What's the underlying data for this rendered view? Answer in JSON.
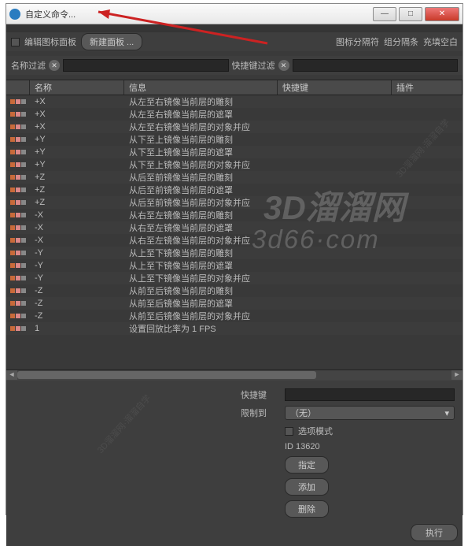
{
  "window": {
    "title": "自定义命令..."
  },
  "toolbar": {
    "edit_icon_panel": "编辑图标面板",
    "new_panel": "新建面板 ...",
    "icon_sep": "图标分隔符",
    "group_sep": "组分隔条",
    "fill_blank": "充填空白"
  },
  "filter": {
    "name_label": "名称过滤",
    "shortcut_label": "快捷键过滤",
    "name_val": "",
    "shortcut_val": ""
  },
  "columns": {
    "name": "名称",
    "info": "信息",
    "shortcut": "快捷键",
    "plugin": "插件"
  },
  "rows": [
    {
      "n": "+X",
      "i": "从左至右镜像当前层的雕刻"
    },
    {
      "n": "+X",
      "i": "从左至右镜像当前层的遮罩"
    },
    {
      "n": "+X",
      "i": "从左至右镜像当前层的对象并应"
    },
    {
      "n": "+Y",
      "i": "从下至上镜像当前层的雕刻"
    },
    {
      "n": "+Y",
      "i": "从下至上镜像当前层的遮罩"
    },
    {
      "n": "+Y",
      "i": "从下至上镜像当前层的对象并应"
    },
    {
      "n": "+Z",
      "i": "从后至前镜像当前层的雕刻"
    },
    {
      "n": "+Z",
      "i": "从后至前镜像当前层的遮罩"
    },
    {
      "n": "+Z",
      "i": "从后至前镜像当前层的对象并应"
    },
    {
      "n": "-X",
      "i": "从右至左镜像当前层的雕刻"
    },
    {
      "n": "-X",
      "i": "从右至左镜像当前层的遮罩"
    },
    {
      "n": "-X",
      "i": "从右至左镜像当前层的对象并应"
    },
    {
      "n": "-Y",
      "i": "从上至下镜像当前层的雕刻"
    },
    {
      "n": "-Y",
      "i": "从上至下镜像当前层的遮罩"
    },
    {
      "n": "-Y",
      "i": "从上至下镜像当前层的对象并应"
    },
    {
      "n": "-Z",
      "i": "从前至后镜像当前层的雕刻"
    },
    {
      "n": "-Z",
      "i": "从前至后镜像当前层的遮罩"
    },
    {
      "n": "-Z",
      "i": "从前至后镜像当前层的对象并应"
    },
    {
      "n": "1",
      "i": "设置回放比率为 1 FPS"
    }
  ],
  "detail": {
    "shortcut_label": "快捷键",
    "shortcut_val": "",
    "limit_label": "限制到",
    "limit_val": "（无）",
    "opt_mode": "选项模式",
    "id_label": "ID 13620",
    "assign": "指定",
    "add": "添加",
    "delete": "删除",
    "execute": "执行"
  },
  "watermark": {
    "line1": "3D溜溜网",
    "line2": "3d66·com",
    "diag": "3D溜溜网·溜溜自学"
  }
}
